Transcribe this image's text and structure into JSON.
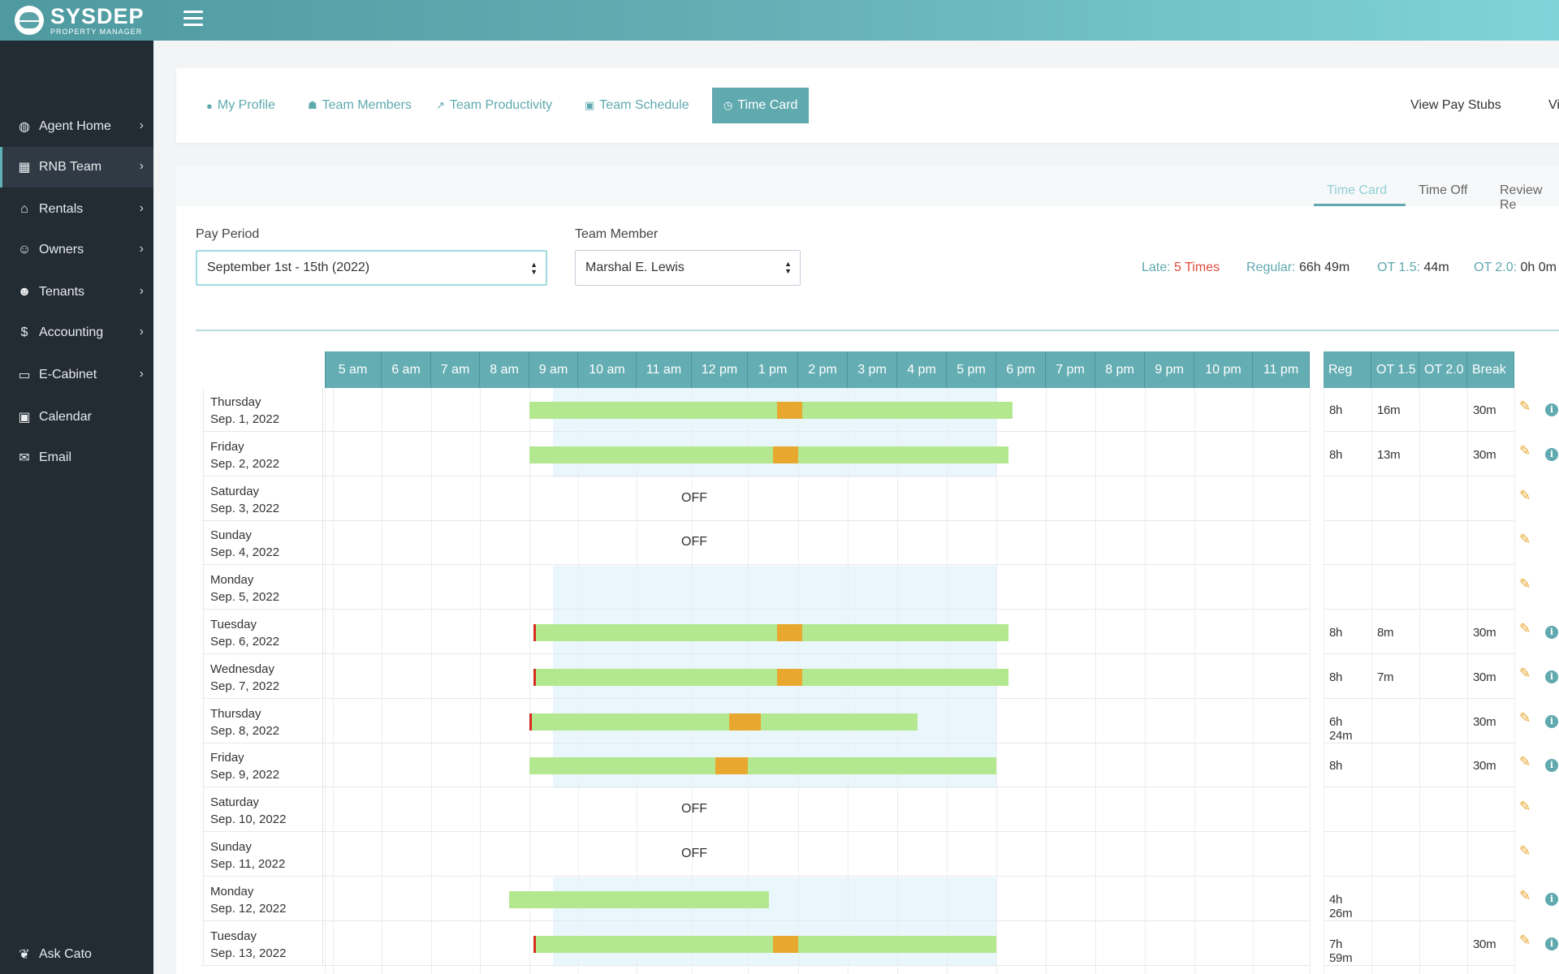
{
  "app": {
    "brand": "SYSDEP",
    "brand_sub": "PROPERTY MANAGER"
  },
  "sidebar": {
    "items": [
      {
        "label": "Agent Home",
        "icon": "globe-icon",
        "chevron": true
      },
      {
        "label": "RNB Team",
        "icon": "grid-icon",
        "chevron": true,
        "active": true
      },
      {
        "label": "Rentals",
        "icon": "home-icon",
        "chevron": true
      },
      {
        "label": "Owners",
        "icon": "user-check-icon",
        "chevron": true
      },
      {
        "label": "Tenants",
        "icon": "users-icon",
        "chevron": true
      },
      {
        "label": "Accounting",
        "icon": "dollar-icon",
        "chevron": true
      },
      {
        "label": "E-Cabinet",
        "icon": "folder-icon",
        "chevron": true
      },
      {
        "label": "Calendar",
        "icon": "calendar-icon",
        "chevron": false
      },
      {
        "label": "Email",
        "icon": "mail-icon",
        "chevron": false
      }
    ],
    "footer": {
      "label": "Ask Cato",
      "icon": "cat-icon"
    }
  },
  "tabs": [
    {
      "label": "My Profile",
      "icon": "person-icon"
    },
    {
      "label": "Team Members",
      "icon": "team-icon"
    },
    {
      "label": "Team Productivity",
      "icon": "trend-icon"
    },
    {
      "label": "Team Schedule",
      "icon": "calendar-small-icon"
    },
    {
      "label": "Time Card",
      "icon": "clock-icon",
      "active": true
    }
  ],
  "tabs_right": [
    "View Pay Stubs",
    "Vi"
  ],
  "subtabs": [
    "Time Card",
    "Time Off",
    "Review Re"
  ],
  "filters": {
    "pay_period_label": "Pay Period",
    "pay_period_value": "September 1st - 15th (2022)",
    "team_member_label": "Team Member",
    "team_member_value": "Marshal E. Lewis"
  },
  "stats": {
    "late_label": "Late:",
    "late_value": "5 Times",
    "regular_label": "Regular:",
    "regular_value": "66h 49m",
    "ot15_label": "OT 1.5:",
    "ot15_value": "44m",
    "ot20_label": "OT 2.0:",
    "ot20_value": "0h 0m"
  },
  "hours": [
    "5 am",
    "6 am",
    "7 am",
    "8 am",
    "9 am",
    "10 am",
    "11 am",
    "12 pm",
    "1 pm",
    "2 pm",
    "3 pm",
    "4 pm",
    "5 pm",
    "6 pm",
    "7 pm",
    "8 pm",
    "9 pm",
    "10 pm",
    "11 pm"
  ],
  "summary_headers": [
    "Reg",
    "OT 1.5",
    "OT 2.0",
    "Break"
  ],
  "off_label": "OFF",
  "colors": {
    "accent": "#5fa9af",
    "work": "#b3e890",
    "break": "#e8a72e",
    "late": "#d62d20",
    "scheduled": "#e9f6fc",
    "sidebar": "#232b33"
  },
  "rows": [
    {
      "day": "Thursday",
      "date": "Sep. 1, 2022",
      "off": false,
      "work": [
        "09:00",
        "18:20"
      ],
      "break": [
        "13:35",
        "14:05"
      ],
      "late": false,
      "reg": "8h",
      "ot15": "16m",
      "ot20": "",
      "brk": "30m",
      "info": true
    },
    {
      "day": "Friday",
      "date": "Sep. 2, 2022",
      "off": false,
      "work": [
        "09:00",
        "18:15"
      ],
      "break": [
        "13:30",
        "14:00"
      ],
      "late": false,
      "reg": "8h",
      "ot15": "13m",
      "ot20": "",
      "brk": "30m",
      "info": true
    },
    {
      "day": "Saturday",
      "date": "Sep. 3, 2022",
      "off": true,
      "reg": "",
      "ot15": "",
      "ot20": "",
      "brk": "",
      "info": false
    },
    {
      "day": "Sunday",
      "date": "Sep. 4, 2022",
      "off": true,
      "reg": "",
      "ot15": "",
      "ot20": "",
      "brk": "",
      "info": false
    },
    {
      "day": "Monday",
      "date": "Sep. 5, 2022",
      "off": false,
      "scheduled_only": true,
      "reg": "",
      "ot15": "",
      "ot20": "",
      "brk": "",
      "info": false
    },
    {
      "day": "Tuesday",
      "date": "Sep. 6, 2022",
      "off": false,
      "work": [
        "09:05",
        "18:15"
      ],
      "break": [
        "13:35",
        "14:05"
      ],
      "late": true,
      "reg": "8h",
      "ot15": "8m",
      "ot20": "",
      "brk": "30m",
      "info": true
    },
    {
      "day": "Wednesday",
      "date": "Sep. 7, 2022",
      "off": false,
      "work": [
        "09:05",
        "18:15"
      ],
      "break": [
        "13:35",
        "14:05"
      ],
      "late": true,
      "reg": "8h",
      "ot15": "7m",
      "ot20": "",
      "brk": "30m",
      "info": true
    },
    {
      "day": "Thursday",
      "date": "Sep. 8, 2022",
      "off": false,
      "work": [
        "09:00",
        "16:25"
      ],
      "break": [
        "12:40",
        "13:15"
      ],
      "late": true,
      "reg": "6h 24m",
      "ot15": "",
      "ot20": "",
      "brk": "30m",
      "info": true
    },
    {
      "day": "Friday",
      "date": "Sep. 9, 2022",
      "off": false,
      "work": [
        "09:00",
        "18:00"
      ],
      "break": [
        "12:25",
        "13:00"
      ],
      "late": false,
      "reg": "8h",
      "ot15": "",
      "ot20": "",
      "brk": "30m",
      "info": true
    },
    {
      "day": "Saturday",
      "date": "Sep. 10, 2022",
      "off": true,
      "reg": "",
      "ot15": "",
      "ot20": "",
      "brk": "",
      "info": false
    },
    {
      "day": "Sunday",
      "date": "Sep. 11, 2022",
      "off": true,
      "reg": "",
      "ot15": "",
      "ot20": "",
      "brk": "",
      "info": false
    },
    {
      "day": "Monday",
      "date": "Sep. 12, 2022",
      "off": false,
      "work": [
        "08:35",
        "13:25"
      ],
      "late": false,
      "reg": "4h 26m",
      "ot15": "",
      "ot20": "",
      "brk": "",
      "info": true
    },
    {
      "day": "Tuesday",
      "date": "Sep. 13, 2022",
      "off": false,
      "work": [
        "09:05",
        "18:00"
      ],
      "break": [
        "13:30",
        "14:00"
      ],
      "late": true,
      "reg": "7h 59m",
      "ot15": "",
      "ot20": "",
      "brk": "30m",
      "info": true
    }
  ]
}
